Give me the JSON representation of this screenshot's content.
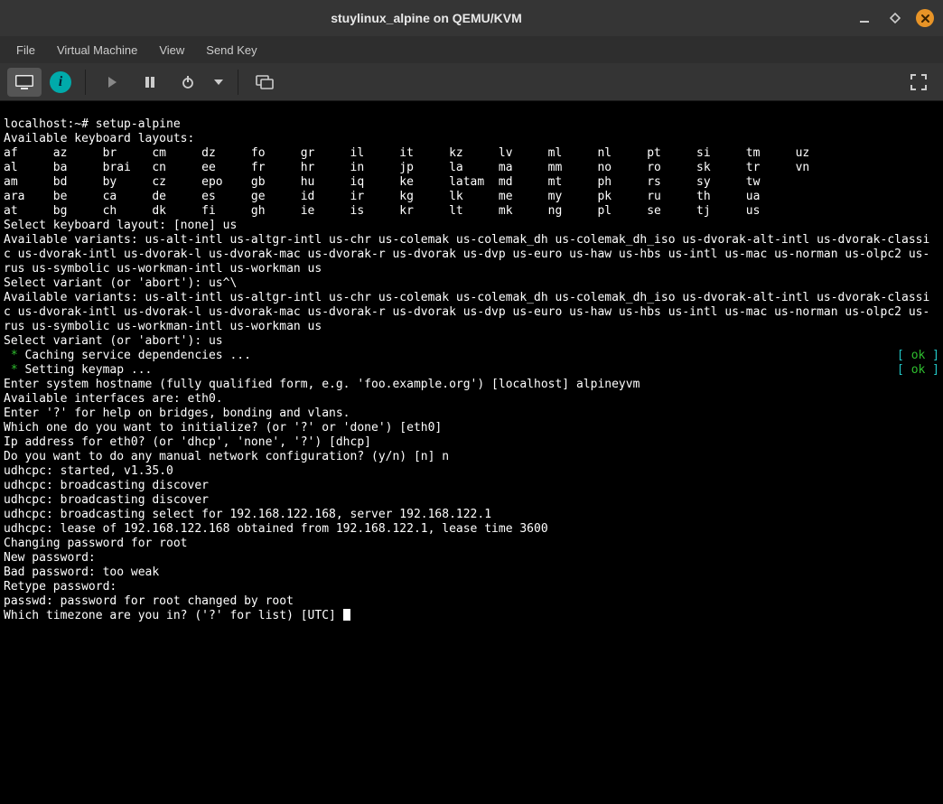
{
  "window": {
    "title": "stuylinux_alpine on QEMU/KVM",
    "min_icon": "minimize-icon",
    "max_icon": "maximize-icon",
    "close_icon": "close-icon"
  },
  "menubar": {
    "items": [
      "File",
      "Virtual Machine",
      "View",
      "Send Key"
    ]
  },
  "toolbar": {
    "monitor_icon": "display-icon",
    "info_label": "i",
    "play_icon": "play-icon",
    "pause_icon": "pause-icon",
    "power_icon": "power-icon",
    "dropdown_icon": "chevron-down-icon",
    "snapshot_icon": "screenshot-icon",
    "fullscreen_icon": "fullscreen-icon"
  },
  "term": {
    "prompt_line": "localhost:~# setup-alpine",
    "avail_layouts": "Available keyboard layouts:",
    "kb_rows": [
      "af     az     br     cm     dz     fo     gr     il     it     kz     lv     ml     nl     pt     si     tm     uz",
      "al     ba     brai   cn     ee     fr     hr     in     jp     la     ma     mm     no     ro     sk     tr     vn",
      "am     bd     by     cz     epo    gb     hu     iq     ke     latam  md     mt     ph     rs     sy     tw",
      "ara    be     ca     de     es     ge     id     ir     kg     lk     me     my     pk     ru     th     ua",
      "at     bg     ch     dk     fi     gh     ie     is     kr     lt     mk     ng     pl     se     tj     us"
    ],
    "select_layout": "Select keyboard layout: [none] us",
    "variants1": "Available variants: us-alt-intl us-altgr-intl us-chr us-colemak us-colemak_dh us-colemak_dh_iso us-dvorak-alt-intl us-dvorak-classic us-dvorak-intl us-dvorak-l us-dvorak-mac us-dvorak-r us-dvorak us-dvp us-euro us-haw us-hbs us-intl us-mac us-norman us-olpc2 us-rus us-symbolic us-workman-intl us-workman us",
    "select_variant1": "Select variant (or 'abort'): us^\\",
    "variants2": "Available variants: us-alt-intl us-altgr-intl us-chr us-colemak us-colemak_dh us-colemak_dh_iso us-dvorak-alt-intl us-dvorak-classic us-dvorak-intl us-dvorak-l us-dvorak-mac us-dvorak-r us-dvorak us-dvp us-euro us-haw us-hbs us-intl us-mac us-norman us-olpc2 us-rus us-symbolic us-workman-intl us-workman us",
    "select_variant2": "Select variant (or 'abort'): us",
    "service1": {
      "star": " * ",
      "text": "Caching service dependencies ...",
      "status_l": "[ ",
      "status_ok": "ok",
      "status_r": " ]"
    },
    "service2": {
      "star": " * ",
      "text": "Setting keymap ...",
      "status_l": "[ ",
      "status_ok": "ok",
      "status_r": " ]"
    },
    "hostname": "Enter system hostname (fully qualified form, e.g. 'foo.example.org') [localhost] alpineyvm",
    "ifaces": "Available interfaces are: eth0.",
    "help": "Enter '?' for help on bridges, bonding and vlans.",
    "which": "Which one do you want to initialize? (or '?' or 'done') [eth0]",
    "ip": "Ip address for eth0? (or 'dhcp', 'none', '?') [dhcp]",
    "manual": "Do you want to do any manual network configuration? (y/n) [n] n",
    "dhcp1": "udhcpc: started, v1.35.0",
    "dhcp2": "udhcpc: broadcasting discover",
    "dhcp3": "udhcpc: broadcasting discover",
    "dhcp4": "udhcpc: broadcasting select for 192.168.122.168, server 192.168.122.1",
    "dhcp5": "udhcpc: lease of 192.168.122.168 obtained from 192.168.122.1, lease time 3600",
    "chpw": "Changing password for root",
    "newpw": "New password:",
    "badpw": "Bad password: too weak",
    "retype": "Retype password:",
    "passwd": "passwd: password for root changed by root",
    "tz": "Which timezone are you in? ('?' for list) [UTC] "
  }
}
